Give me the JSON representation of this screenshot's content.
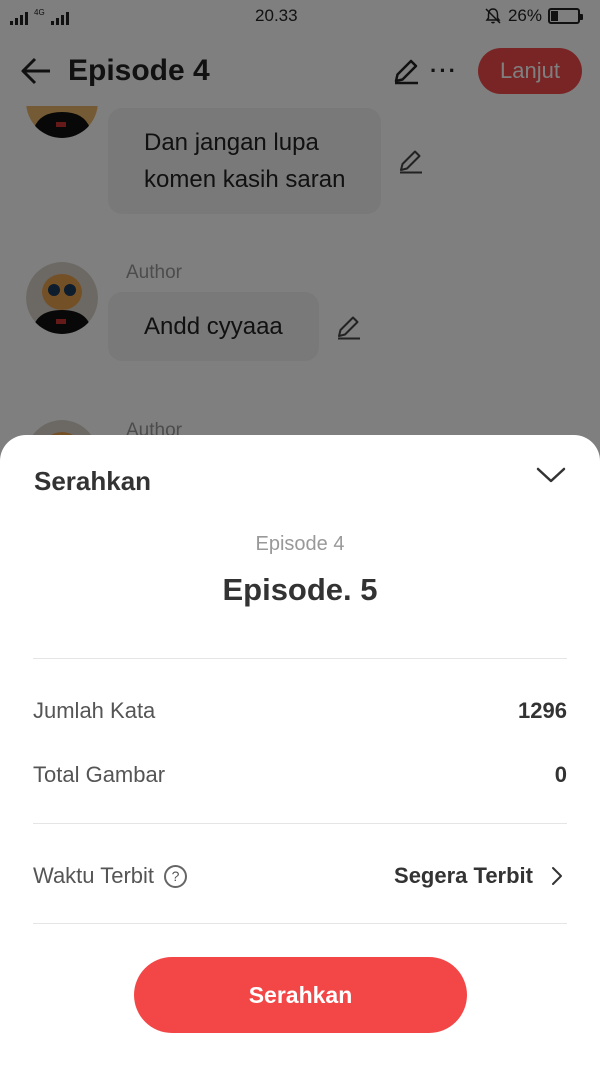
{
  "status_bar": {
    "network": "4G",
    "time": "20.33",
    "battery_text": "26%",
    "battery_level": 0.26,
    "icons": [
      "signal-icon",
      "alarm-off-icon",
      "battery-icon"
    ]
  },
  "header": {
    "title": "Episode 4",
    "next_label": "Lanjut",
    "more_label": "···"
  },
  "chat": {
    "messages": [
      {
        "author": "",
        "text_lines": [
          "Dan jangan lupa",
          "komen kasih saran"
        ]
      },
      {
        "author": "Author",
        "text": "Andd cyyaaa"
      },
      {
        "author": "Author",
        "text": ""
      }
    ]
  },
  "sheet": {
    "title": "Serahkan",
    "episode_subtitle": "Episode 4",
    "episode_name": "Episode. 5",
    "word_count_label": "Jumlah Kata",
    "word_count_value": "1296",
    "image_count_label": "Total Gambar",
    "image_count_value": "0",
    "publish_time_label": "Waktu Terbit",
    "help_glyph": "?",
    "publish_time_value": "Segera Terbit",
    "submit_label": "Serahkan"
  },
  "colors": {
    "accent": "#f34747",
    "overlay": "rgba(0,0,0,0.5)"
  }
}
